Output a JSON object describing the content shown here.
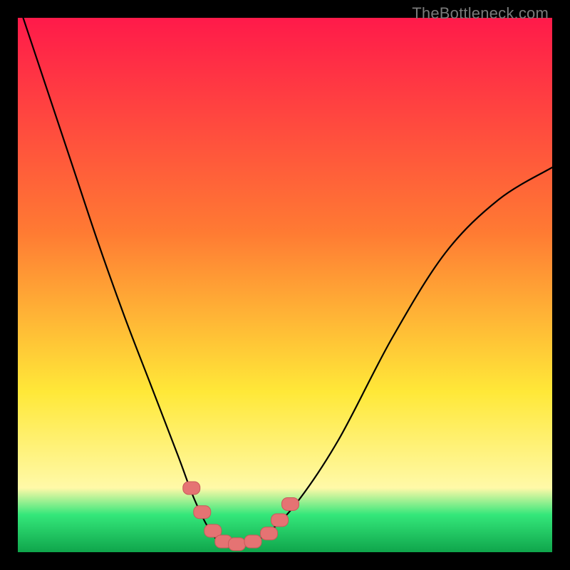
{
  "watermark": "TheBottleneck.com",
  "colors": {
    "frame": "#000000",
    "curve": "#000000",
    "marker_fill": "#e57373",
    "marker_stroke": "#c95a5a",
    "grad_top": "#ff1a4a",
    "grad_mid1": "#ff7a33",
    "grad_mid2": "#ffe838",
    "grad_band": "#fff9a8",
    "grad_green": "#34e77a",
    "grad_bottom": "#0fa54b"
  },
  "chart_data": {
    "type": "line",
    "title": "",
    "xlabel": "",
    "ylabel": "",
    "xlim": [
      0,
      1
    ],
    "ylim": [
      0,
      1
    ],
    "legend": false,
    "grid": false,
    "series": [
      {
        "name": "bottleneck-curve",
        "x": [
          0.0,
          0.05,
          0.1,
          0.15,
          0.2,
          0.25,
          0.3,
          0.33,
          0.36,
          0.385,
          0.42,
          0.46,
          0.52,
          0.6,
          0.7,
          0.8,
          0.9,
          1.0
        ],
        "values": [
          1.03,
          0.88,
          0.73,
          0.58,
          0.44,
          0.31,
          0.18,
          0.1,
          0.04,
          0.015,
          0.015,
          0.03,
          0.09,
          0.21,
          0.4,
          0.56,
          0.66,
          0.72
        ]
      }
    ],
    "markers": {
      "name": "highlighted-points",
      "x": [
        0.325,
        0.345,
        0.365,
        0.385,
        0.41,
        0.44,
        0.47,
        0.49,
        0.51
      ],
      "values": [
        0.12,
        0.075,
        0.04,
        0.02,
        0.015,
        0.02,
        0.035,
        0.06,
        0.09
      ]
    },
    "annotations": []
  }
}
